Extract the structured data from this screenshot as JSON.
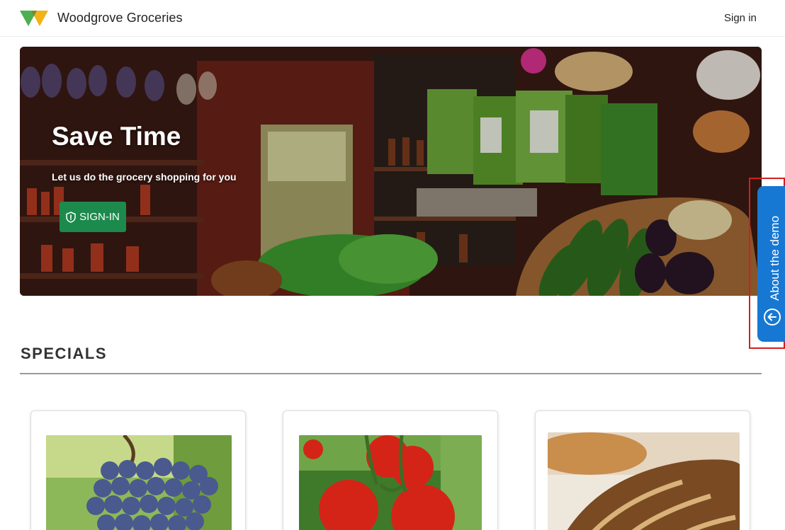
{
  "header": {
    "brand": "Woodgrove Groceries",
    "sign_in": "Sign in"
  },
  "hero": {
    "title": "Save Time",
    "subtitle": "Let us do the grocery shopping for you",
    "button_label": "SIGN-IN",
    "button_icon": "shield-icon"
  },
  "specials": {
    "title": "SPECIALS",
    "products": [
      {
        "image": "grapes-image"
      },
      {
        "image": "tomatoes-image"
      },
      {
        "image": "bread-image"
      }
    ]
  },
  "side_tab": {
    "label": "About the demo",
    "icon": "arrow-left-circle-icon"
  },
  "colors": {
    "accent_green": "#1c8a4c",
    "tab_blue": "#1678d2",
    "highlight_red": "#d21f1f"
  }
}
